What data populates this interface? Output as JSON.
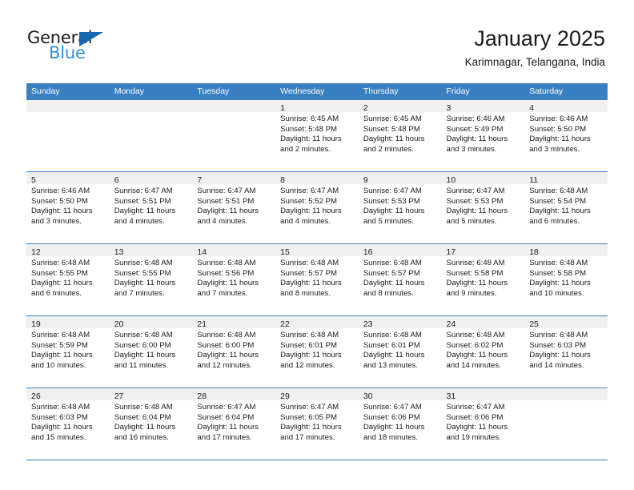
{
  "brand": {
    "line1": "General",
    "line2": "Blue",
    "triangle_color": "#1667b2",
    "blue_text_color": "#2e90d9"
  },
  "header": {
    "title": "January 2025",
    "subtitle": "Karimnagar, Telangana, India"
  },
  "theme": {
    "header_blue": "#3a7fc1",
    "daynum_band": "#f0f0f0",
    "text": "#1b1b1b"
  },
  "weekday_headers": [
    "Sunday",
    "Monday",
    "Tuesday",
    "Wednesday",
    "Thursday",
    "Friday",
    "Saturday"
  ],
  "labels": {
    "sunrise_prefix": "Sunrise:",
    "sunset_prefix": "Sunset:",
    "daylight_prefix": "Daylight:"
  },
  "weeks": [
    [
      {
        "day": "",
        "sunrise": "",
        "sunset": "",
        "daylight_1": "",
        "daylight_2": "",
        "empty": true
      },
      {
        "day": "",
        "sunrise": "",
        "sunset": "",
        "daylight_1": "",
        "daylight_2": "",
        "empty": true
      },
      {
        "day": "",
        "sunrise": "",
        "sunset": "",
        "daylight_1": "",
        "daylight_2": "",
        "empty": true
      },
      {
        "day": "1",
        "sunrise": "Sunrise: 6:45 AM",
        "sunset": "Sunset: 5:48 PM",
        "daylight_1": "Daylight: 11 hours",
        "daylight_2": "and 2 minutes."
      },
      {
        "day": "2",
        "sunrise": "Sunrise: 6:45 AM",
        "sunset": "Sunset: 5:48 PM",
        "daylight_1": "Daylight: 11 hours",
        "daylight_2": "and 2 minutes."
      },
      {
        "day": "3",
        "sunrise": "Sunrise: 6:46 AM",
        "sunset": "Sunset: 5:49 PM",
        "daylight_1": "Daylight: 11 hours",
        "daylight_2": "and 3 minutes."
      },
      {
        "day": "4",
        "sunrise": "Sunrise: 6:46 AM",
        "sunset": "Sunset: 5:50 PM",
        "daylight_1": "Daylight: 11 hours",
        "daylight_2": "and 3 minutes."
      }
    ],
    [
      {
        "day": "5",
        "sunrise": "Sunrise: 6:46 AM",
        "sunset": "Sunset: 5:50 PM",
        "daylight_1": "Daylight: 11 hours",
        "daylight_2": "and 3 minutes."
      },
      {
        "day": "6",
        "sunrise": "Sunrise: 6:47 AM",
        "sunset": "Sunset: 5:51 PM",
        "daylight_1": "Daylight: 11 hours",
        "daylight_2": "and 4 minutes."
      },
      {
        "day": "7",
        "sunrise": "Sunrise: 6:47 AM",
        "sunset": "Sunset: 5:51 PM",
        "daylight_1": "Daylight: 11 hours",
        "daylight_2": "and 4 minutes."
      },
      {
        "day": "8",
        "sunrise": "Sunrise: 6:47 AM",
        "sunset": "Sunset: 5:52 PM",
        "daylight_1": "Daylight: 11 hours",
        "daylight_2": "and 4 minutes."
      },
      {
        "day": "9",
        "sunrise": "Sunrise: 6:47 AM",
        "sunset": "Sunset: 5:53 PM",
        "daylight_1": "Daylight: 11 hours",
        "daylight_2": "and 5 minutes."
      },
      {
        "day": "10",
        "sunrise": "Sunrise: 6:47 AM",
        "sunset": "Sunset: 5:53 PM",
        "daylight_1": "Daylight: 11 hours",
        "daylight_2": "and 5 minutes."
      },
      {
        "day": "11",
        "sunrise": "Sunrise: 6:48 AM",
        "sunset": "Sunset: 5:54 PM",
        "daylight_1": "Daylight: 11 hours",
        "daylight_2": "and 6 minutes."
      }
    ],
    [
      {
        "day": "12",
        "sunrise": "Sunrise: 6:48 AM",
        "sunset": "Sunset: 5:55 PM",
        "daylight_1": "Daylight: 11 hours",
        "daylight_2": "and 6 minutes."
      },
      {
        "day": "13",
        "sunrise": "Sunrise: 6:48 AM",
        "sunset": "Sunset: 5:55 PM",
        "daylight_1": "Daylight: 11 hours",
        "daylight_2": "and 7 minutes."
      },
      {
        "day": "14",
        "sunrise": "Sunrise: 6:48 AM",
        "sunset": "Sunset: 5:56 PM",
        "daylight_1": "Daylight: 11 hours",
        "daylight_2": "and 7 minutes."
      },
      {
        "day": "15",
        "sunrise": "Sunrise: 6:48 AM",
        "sunset": "Sunset: 5:57 PM",
        "daylight_1": "Daylight: 11 hours",
        "daylight_2": "and 8 minutes."
      },
      {
        "day": "16",
        "sunrise": "Sunrise: 6:48 AM",
        "sunset": "Sunset: 5:57 PM",
        "daylight_1": "Daylight: 11 hours",
        "daylight_2": "and 8 minutes."
      },
      {
        "day": "17",
        "sunrise": "Sunrise: 6:48 AM",
        "sunset": "Sunset: 5:58 PM",
        "daylight_1": "Daylight: 11 hours",
        "daylight_2": "and 9 minutes."
      },
      {
        "day": "18",
        "sunrise": "Sunrise: 6:48 AM",
        "sunset": "Sunset: 5:58 PM",
        "daylight_1": "Daylight: 11 hours",
        "daylight_2": "and 10 minutes."
      }
    ],
    [
      {
        "day": "19",
        "sunrise": "Sunrise: 6:48 AM",
        "sunset": "Sunset: 5:59 PM",
        "daylight_1": "Daylight: 11 hours",
        "daylight_2": "and 10 minutes."
      },
      {
        "day": "20",
        "sunrise": "Sunrise: 6:48 AM",
        "sunset": "Sunset: 6:00 PM",
        "daylight_1": "Daylight: 11 hours",
        "daylight_2": "and 11 minutes."
      },
      {
        "day": "21",
        "sunrise": "Sunrise: 6:48 AM",
        "sunset": "Sunset: 6:00 PM",
        "daylight_1": "Daylight: 11 hours",
        "daylight_2": "and 12 minutes."
      },
      {
        "day": "22",
        "sunrise": "Sunrise: 6:48 AM",
        "sunset": "Sunset: 6:01 PM",
        "daylight_1": "Daylight: 11 hours",
        "daylight_2": "and 12 minutes."
      },
      {
        "day": "23",
        "sunrise": "Sunrise: 6:48 AM",
        "sunset": "Sunset: 6:01 PM",
        "daylight_1": "Daylight: 11 hours",
        "daylight_2": "and 13 minutes."
      },
      {
        "day": "24",
        "sunrise": "Sunrise: 6:48 AM",
        "sunset": "Sunset: 6:02 PM",
        "daylight_1": "Daylight: 11 hours",
        "daylight_2": "and 14 minutes."
      },
      {
        "day": "25",
        "sunrise": "Sunrise: 6:48 AM",
        "sunset": "Sunset: 6:03 PM",
        "daylight_1": "Daylight: 11 hours",
        "daylight_2": "and 14 minutes."
      }
    ],
    [
      {
        "day": "26",
        "sunrise": "Sunrise: 6:48 AM",
        "sunset": "Sunset: 6:03 PM",
        "daylight_1": "Daylight: 11 hours",
        "daylight_2": "and 15 minutes."
      },
      {
        "day": "27",
        "sunrise": "Sunrise: 6:48 AM",
        "sunset": "Sunset: 6:04 PM",
        "daylight_1": "Daylight: 11 hours",
        "daylight_2": "and 16 minutes."
      },
      {
        "day": "28",
        "sunrise": "Sunrise: 6:47 AM",
        "sunset": "Sunset: 6:04 PM",
        "daylight_1": "Daylight: 11 hours",
        "daylight_2": "and 17 minutes."
      },
      {
        "day": "29",
        "sunrise": "Sunrise: 6:47 AM",
        "sunset": "Sunset: 6:05 PM",
        "daylight_1": "Daylight: 11 hours",
        "daylight_2": "and 17 minutes."
      },
      {
        "day": "30",
        "sunrise": "Sunrise: 6:47 AM",
        "sunset": "Sunset: 6:06 PM",
        "daylight_1": "Daylight: 11 hours",
        "daylight_2": "and 18 minutes."
      },
      {
        "day": "31",
        "sunrise": "Sunrise: 6:47 AM",
        "sunset": "Sunset: 6:06 PM",
        "daylight_1": "Daylight: 11 hours",
        "daylight_2": "and 19 minutes."
      },
      {
        "day": "",
        "sunrise": "",
        "sunset": "",
        "daylight_1": "",
        "daylight_2": "",
        "empty": true
      }
    ]
  ]
}
